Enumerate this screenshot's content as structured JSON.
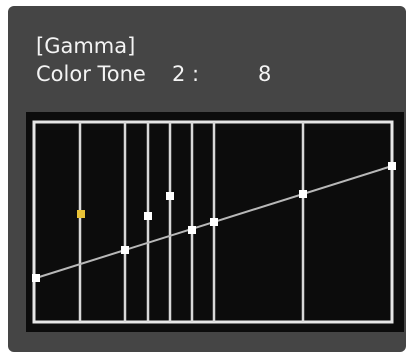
{
  "header": {
    "title": "[Gamma]",
    "tone_label": "Color Tone",
    "tone_index": "2 :",
    "tone_value": "8"
  },
  "graph": {
    "selected_point_index": 1,
    "colors": {
      "background": "#0c0c0c",
      "grid": "#d8d8d8",
      "point": "#ffffff",
      "selected_point": "#e8c237",
      "panel": "#454545"
    }
  }
}
